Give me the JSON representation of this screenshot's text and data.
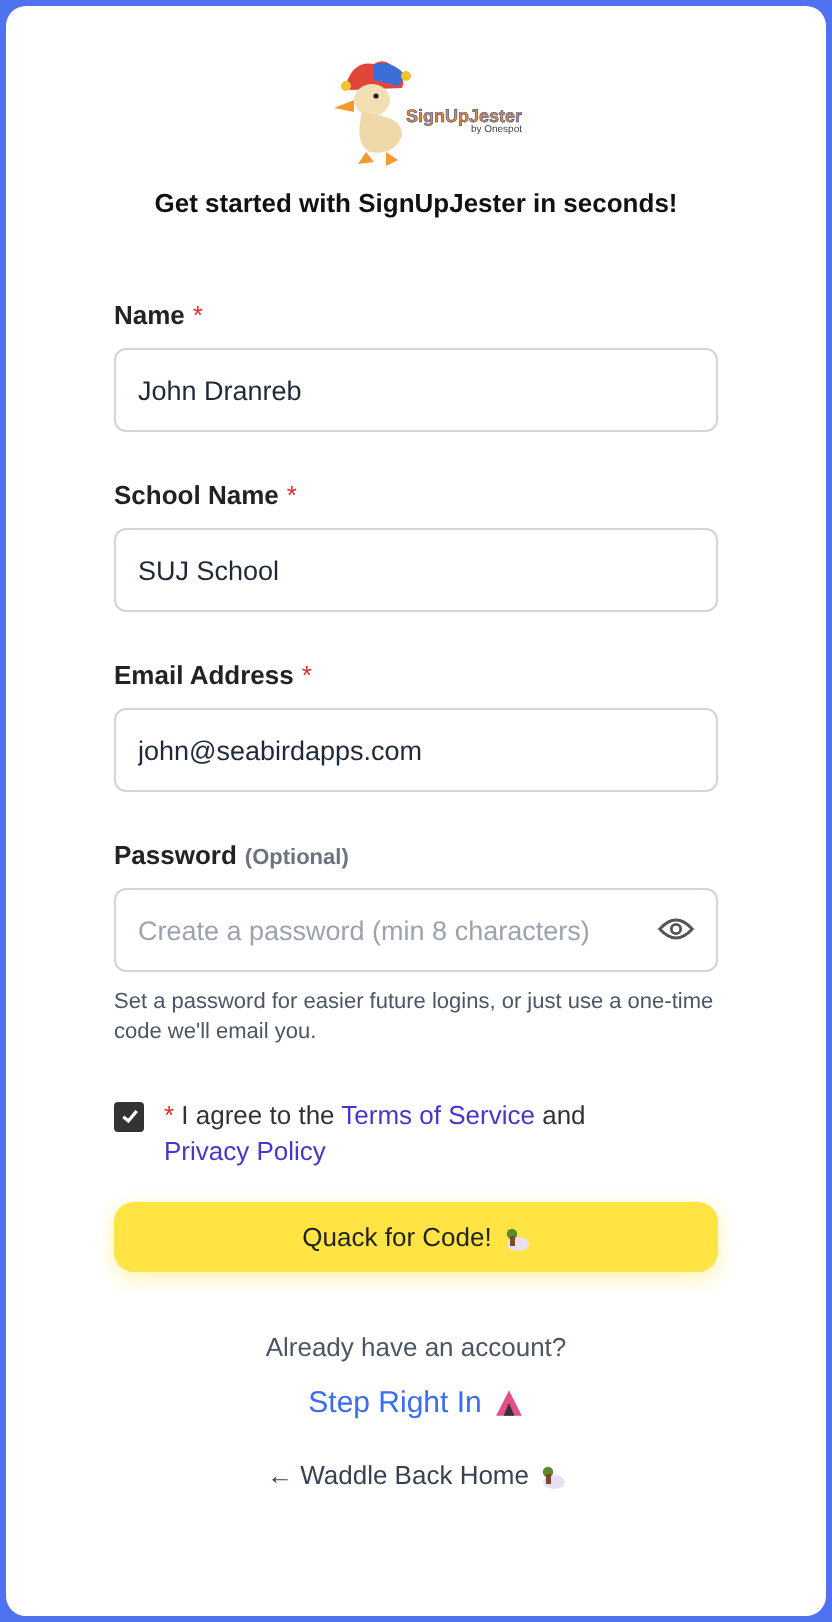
{
  "logo": {
    "name": "SignUpJester",
    "byline": "by Onespot"
  },
  "heading": "Get started with SignUpJester in seconds!",
  "required_mark": "*",
  "fields": [
    {
      "kind": "text",
      "label": "Name",
      "required": true,
      "value": "John Dranreb"
    },
    {
      "kind": "text",
      "label": "School Name",
      "required": true,
      "value": "SUJ School"
    },
    {
      "kind": "text",
      "label": "Email Address",
      "required": true,
      "value": "john@seabirdapps.com"
    },
    {
      "kind": "password",
      "label": "Password",
      "note": "(Optional)",
      "required": false,
      "placeholder": "Create a password (min 8 characters)",
      "hint": "Set a password for easier future logins, or just use a one-time code we'll email you."
    }
  ],
  "agreement": {
    "checked": true,
    "required": true,
    "prefix": "I agree to the",
    "terms_link": "Terms of Service",
    "joiner": "and",
    "privacy_link": "Privacy Policy"
  },
  "submit_button": "Quack for Code!",
  "login_prompt": "Already have an account?",
  "login_link": "Step Right In",
  "back_link": {
    "arrow": "←",
    "label": "Waddle Back Home"
  }
}
